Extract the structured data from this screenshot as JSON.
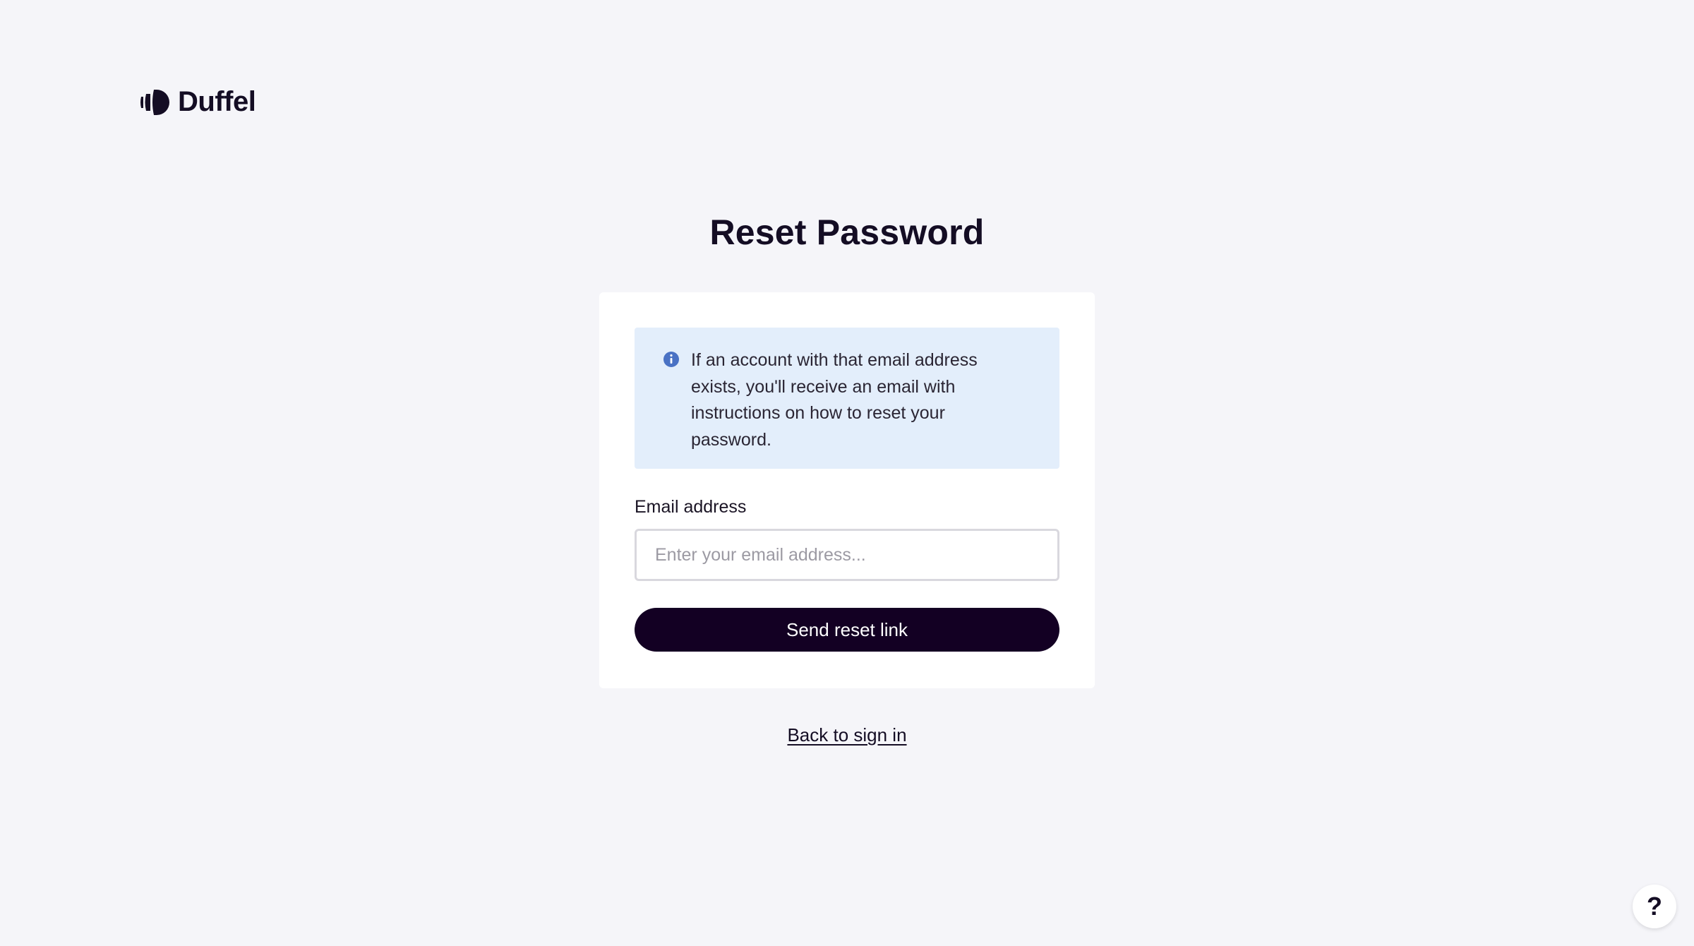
{
  "brand": {
    "name": "Duffel",
    "logo_icon": "duffel-logo-icon",
    "color": "#140d24"
  },
  "page": {
    "title": "Reset Password"
  },
  "info_banner": {
    "icon": "info-icon",
    "text": "If an account with that email address exists, you'll receive an email with instructions on how to reset your password.",
    "background": "#e3eefb",
    "icon_color": "#4a72c4"
  },
  "form": {
    "email_label": "Email address",
    "email_placeholder": "Enter your email address...",
    "email_value": "",
    "submit_label": "Send reset link",
    "submit_color": "#130023"
  },
  "footer": {
    "back_link": "Back to sign in"
  },
  "help": {
    "label": "?",
    "icon": "help-icon"
  }
}
